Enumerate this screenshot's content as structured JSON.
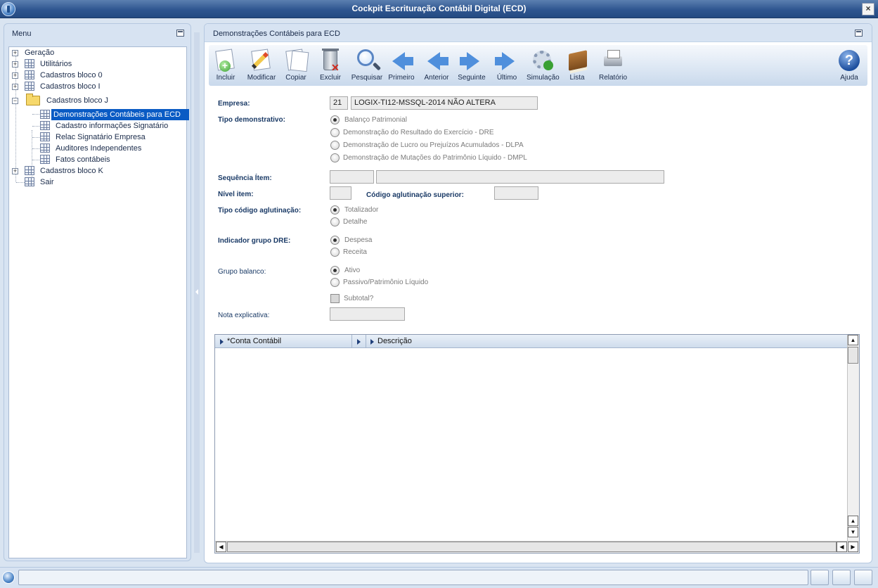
{
  "window": {
    "title": "Cockpit Escrituração Contábil Digital (ECD)",
    "close_symbol": "×"
  },
  "menu": {
    "title": "Menu",
    "items": [
      {
        "label": "Geração",
        "expander": "+"
      },
      {
        "label": "Utilitários",
        "expander": "+"
      },
      {
        "label": "Cadastros bloco 0",
        "expander": "+"
      },
      {
        "label": "Cadastros bloco I",
        "expander": "+"
      },
      {
        "label": "Cadastros bloco J",
        "expander": "−"
      },
      {
        "label": "Demonstrações Contábeis para ECD"
      },
      {
        "label": "Cadastro informações Signatário"
      },
      {
        "label": "Relac Signatário Empresa"
      },
      {
        "label": "Auditores Independentes"
      },
      {
        "label": "Fatos contábeis"
      },
      {
        "label": "Cadastros bloco K",
        "expander": "+"
      },
      {
        "label": "Sair"
      }
    ]
  },
  "content": {
    "title": "Demonstrações Contábeis para ECD",
    "toolbar": {
      "incluir": "Incluir",
      "modificar": "Modificar",
      "copiar": "Copiar",
      "excluir": "Excluir",
      "pesquisar": "Pesquisar",
      "primeiro": "Primeiro",
      "anterior": "Anterior",
      "seguinte": "Seguinte",
      "ultimo": "Último",
      "simulacao": "Simulação",
      "lista": "Lista",
      "relatorio": "Relatório",
      "ajuda": "Ajuda",
      "help_symbol": "?",
      "plus_symbol": "+",
      "x_symbol": "✕"
    },
    "form": {
      "empresa_label": "Empresa:",
      "empresa_code": "21",
      "empresa_name": "LOGIX-TI12-MSSQL-2014 NÃO ALTERA",
      "tipo_demonstrativo_label": "Tipo demonstrativo:",
      "tipo_demonstrativo_options": [
        "Balanço Patrimonial",
        "Demonstração do Resultado do Exercício - DRE",
        "Demonstração de Lucro ou Prejuízos Acumulados - DLPA",
        "Demonstração de Mutações do Patrimônio Líquido - DMPL"
      ],
      "tipo_demonstrativo_selected": "Balanço Patrimonial",
      "sequencia_label": "Sequência Ítem:",
      "sequencia_value": "",
      "sequencia_desc": "",
      "nivel_label": "Nível item:",
      "nivel_value": "",
      "codigo_aglut_sup_label": "Código aglutinação superior:",
      "codigo_aglut_sup_value": "",
      "tipo_codigo_label": "Tipo código aglutinação:",
      "tipo_codigo_options": [
        "Totalizador",
        "Detalhe"
      ],
      "tipo_codigo_selected": "Totalizador",
      "indicador_dre_label": "Indicador grupo DRE:",
      "indicador_dre_options": [
        "Despesa",
        "Receita"
      ],
      "indicador_dre_selected": "Despesa",
      "grupo_balanco_label": "Grupo balanco:",
      "grupo_balanco_options": [
        "Ativo",
        "Passivo/Patrimônio Líquido"
      ],
      "grupo_balanco_selected": "Ativo",
      "subtotal_label": "Subtotal?",
      "subtotal_checked": false,
      "nota_label": "Nota explicativa:",
      "nota_value": ""
    },
    "grid": {
      "columns": [
        "*Conta Contábil",
        "Descrição"
      ],
      "rows": []
    }
  },
  "colors": {
    "accent": "#0a5bc4",
    "title_bar": "#2f5690",
    "panel_bg": "#d7e3f2"
  }
}
